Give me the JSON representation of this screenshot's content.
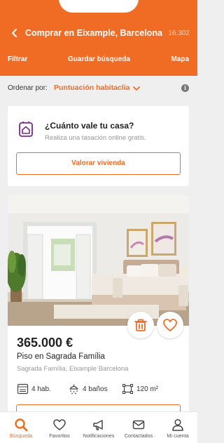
{
  "header": {
    "title": "Comprar en Eixample, Barcelona",
    "count": "16.302",
    "back_icon": "chevron-left-icon",
    "actions": {
      "filter": "Filtrar",
      "save_search": "Guardar búsqueda",
      "map": "Mapa"
    }
  },
  "sort": {
    "label": "Ordenar por:",
    "value": "Puntuación habitaclia",
    "info_icon": "info-icon"
  },
  "valuation": {
    "title": "¿Cuánto vale tu casa?",
    "subtitle": "Realiza una tasación online gratis.",
    "button": "Valorar vivienda"
  },
  "listing": {
    "price": "365.000 €",
    "name": "Piso en Sagrada Família",
    "location": "Sagrada Família, Eixample Barcelona",
    "features": {
      "rooms": "4 hab.",
      "baths": "4 baños",
      "area": "120 m²"
    }
  },
  "tabs": [
    {
      "label": "Búsqueda",
      "icon": "search-icon",
      "active": true
    },
    {
      "label": "Favoritos",
      "icon": "heart-icon",
      "active": false
    },
    {
      "label": "Notificaciones",
      "icon": "megaphone-icon",
      "active": false
    },
    {
      "label": "Contactados",
      "icon": "mail-icon",
      "active": false
    },
    {
      "label": "Mi cuenta",
      "icon": "user-icon",
      "active": false
    }
  ],
  "colors": {
    "brand": "#f06b23",
    "accent_purple": "#7a2c8f"
  }
}
